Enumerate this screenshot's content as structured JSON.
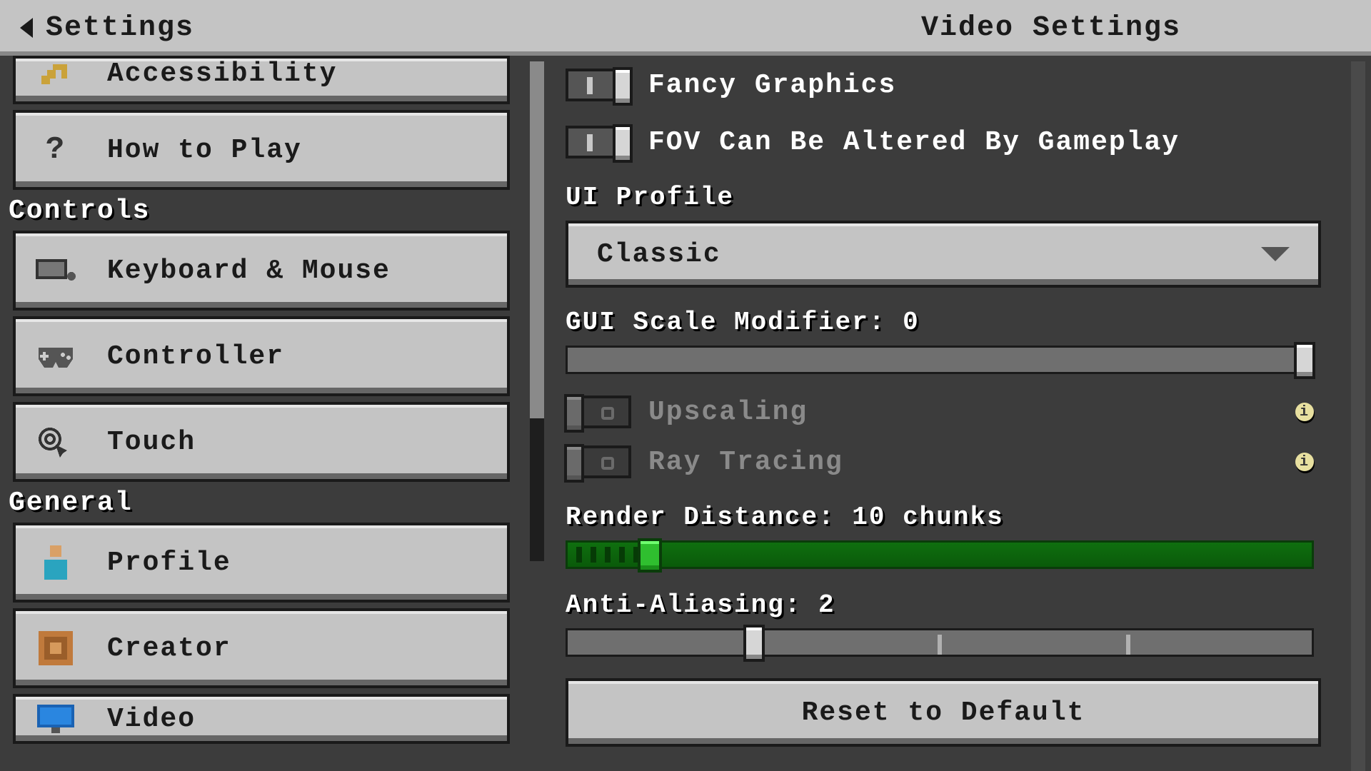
{
  "header": {
    "back_label": "Settings",
    "page_title": "Video Settings"
  },
  "sidebar": {
    "categories": [
      {
        "name": "",
        "items": [
          {
            "id": "accessibility",
            "label": "Accessibility",
            "icon": "key"
          },
          {
            "id": "how-to-play",
            "label": "How to Play",
            "icon": "question"
          }
        ]
      },
      {
        "name": "Controls",
        "items": [
          {
            "id": "keyboard-mouse",
            "label": "Keyboard & Mouse",
            "icon": "keyboard"
          },
          {
            "id": "controller",
            "label": "Controller",
            "icon": "gamepad"
          },
          {
            "id": "touch",
            "label": "Touch",
            "icon": "touch"
          }
        ]
      },
      {
        "name": "General",
        "items": [
          {
            "id": "profile",
            "label": "Profile",
            "icon": "profile"
          },
          {
            "id": "creator",
            "label": "Creator",
            "icon": "command-block"
          },
          {
            "id": "video",
            "label": "Video",
            "icon": "monitor"
          }
        ]
      }
    ]
  },
  "settings": {
    "fancy_graphics": {
      "label": "Fancy Graphics",
      "value": true
    },
    "fov_gameplay": {
      "label": "FOV Can Be Altered By Gameplay",
      "value": true
    },
    "ui_profile": {
      "label": "UI Profile",
      "value": "Classic"
    },
    "gui_scale": {
      "label": "GUI Scale Modifier: 0",
      "value": 0,
      "min": -3,
      "max": 0,
      "knob_pct": 99
    },
    "upscaling": {
      "label": "Upscaling",
      "value": false,
      "disabled": true,
      "info": true
    },
    "ray_tracing": {
      "label": "Ray Tracing",
      "value": false,
      "disabled": true,
      "info": true
    },
    "render_distance": {
      "label": "Render Distance: 10 chunks",
      "value": 10,
      "min": 4,
      "max": 96,
      "knob_pct": 11
    },
    "anti_aliasing": {
      "label": "Anti-Aliasing: 2",
      "value": 2,
      "min": 1,
      "max": 4,
      "knob_pct": 25
    },
    "reset_label": "Reset to Default"
  },
  "colors": {
    "panel": "#c4c4c4",
    "dark": "#1a1a1a",
    "bg": "#3c3c3c",
    "slider_green": "#0f6f0f",
    "slider_green_knob": "#2fbf2f",
    "info_badge": "#e8e0a0"
  }
}
